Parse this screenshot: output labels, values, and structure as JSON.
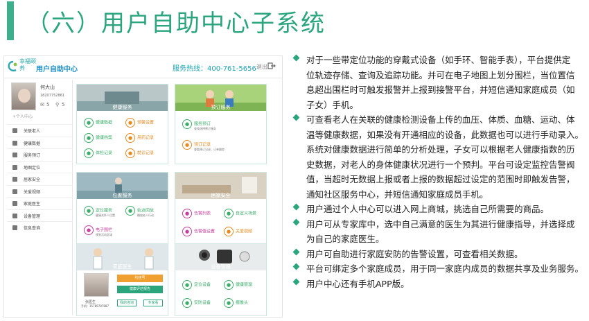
{
  "title": "（六）用户自助中心子系统",
  "app": {
    "logo_text": "幸福颐养",
    "name": "用户自助中心",
    "hotline": "服务热线：400-761-5656",
    "exit": "退出"
  },
  "profile": {
    "name": "何大山",
    "phone": "18207752861",
    "count_a": "5",
    "count_b": "5",
    "center_link": "+个人中心"
  },
  "sidebar": [
    {
      "label": "关联老人"
    },
    {
      "label": "健康数据"
    },
    {
      "label": "服务预订"
    },
    {
      "label": "地图定位"
    },
    {
      "label": "居家安全"
    },
    {
      "label": "关爱视频"
    },
    {
      "label": "家庭医生"
    },
    {
      "label": "设备管理"
    },
    {
      "label": "信息查询"
    }
  ],
  "tiles": [
    {
      "title": "健康服务",
      "items": [
        {
          "label": "健康数据",
          "color": "#3cae6a"
        },
        {
          "label": "预警设置",
          "color": "#e68a22"
        },
        {
          "label": "健康档案",
          "color": "#3cae6a"
        },
        {
          "label": "用药记录",
          "color": "#e68a22"
        },
        {
          "label": "体检记录",
          "color": "#3cae6a"
        },
        {
          "label": "就诊记录",
          "color": "#e68a22"
        }
      ]
    },
    {
      "title": "预订服务",
      "items": [
        {
          "label": "服务预订",
          "sub": "查找选择预订服务",
          "color": "#3cae6a"
        },
        {
          "label": "预订记录",
          "sub": "查看预订记录，订单跟踪",
          "color": "#e68a22"
        }
      ]
    },
    {
      "title": "位置服务",
      "items": [
        {
          "label": "定位服务",
          "sub": "健康关怀人位置",
          "color": "#3cae6a"
        },
        {
          "label": "轨迹回放",
          "sub": "播放老人行动",
          "color": "#3cae6a"
        },
        {
          "label": "电子围栏",
          "sub": "规划活动区域",
          "color": "#c53e9c"
        }
      ]
    },
    {
      "title": "居家安全",
      "items": [
        {
          "label": "告警列表",
          "color": "#c53e9c"
        },
        {
          "label": "自定义场景",
          "color": "#3cae6a"
        },
        {
          "label": "告警值设置",
          "color": "#c53e9c"
        },
        {
          "label": "关爱视频",
          "color": "#e68a22"
        }
      ]
    },
    {
      "title": "家庭医生",
      "items": [
        {
          "label": "约挂号"
        },
        {
          "label": "健康评估报告"
        },
        {
          "label": "我的咨询"
        },
        {
          "label": "专家看"
        }
      ],
      "doctor_name": "张医生",
      "doctor_phone": "手机：15789787887"
    },
    {
      "title": "设备管理",
      "items": [
        {
          "label": "定位设备",
          "color": "#3cae6a"
        },
        {
          "label": "健康管理",
          "color": "#3cae6a"
        },
        {
          "label": "安防设备",
          "color": "#3cae6a"
        },
        {
          "label": "摄像头",
          "color": "#3cae6a"
        }
      ]
    }
  ],
  "bullets": [
    {
      "lines": [
        "对于一些带定位功能的穿戴式设备（如手环、智能手表），平台提供定",
        "位轨迹存储、查询及追踪功能。并可在电子地图上划分围栏，当位置信",
        "息超出围栏时可触发报警并上报到接警平台，并短信通知家庭成员（如",
        "子女）手机。"
      ]
    },
    {
      "lines": [
        "可查看老人在关联的健康检测设备上传的血压、体质、血糖、运动、体",
        "温等健康数据，如果没有开通相应的设备，此数据也可以进行手动录入。",
        "系统对健康数据进行简单的分析处理，子女可以根据老人健康指数的历",
        "史数据，对老人的身体健康状况进行一个预判。平台可设定监控告警阀",
        "值，当超时无数据上报或者上报的数据超过设定的范围时即触发告警，",
        "通知社区服务中心，并短信通知家庭成员手机。"
      ]
    },
    {
      "lines": [
        "用户通过个人中心可以进入网上商城，挑选自己所需要的商品。"
      ]
    },
    {
      "lines": [
        "用户可从专家库中，选中自己满意的医生为其进行健康指导，并选择成",
        "为自己的家庭医生。"
      ]
    },
    {
      "lines": [
        "用户可自助进行家庭安防的告警设置，可查看相关数据。"
      ]
    },
    {
      "lines": [
        "平台可绑定多个家庭成员，用于同一家庭内成员的数据共享及业务服务。"
      ]
    },
    {
      "lines": [
        "用户中心还有手机APP版。"
      ]
    }
  ]
}
